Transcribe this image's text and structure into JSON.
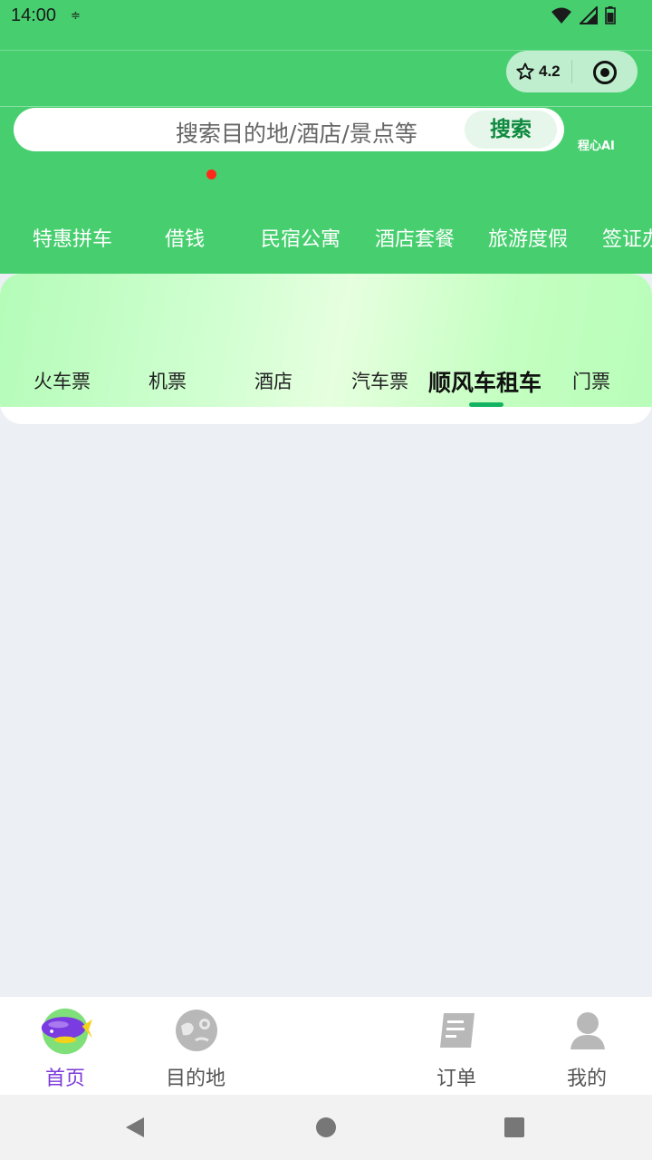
{
  "status_bar": {
    "time": "14:00",
    "extra": "≑"
  },
  "capsule": {
    "rating": "4.2"
  },
  "search": {
    "placeholder": "搜索目的地/酒店/景点等",
    "button_label": "搜索",
    "ai_label": "程心AI"
  },
  "quick_nav": {
    "items": [
      "特惠拼车",
      "借钱",
      "民宿公寓",
      "酒店套餐",
      "旅游度假",
      "签证办"
    ]
  },
  "tabs": {
    "items": [
      "火车票",
      "机票",
      "酒店",
      "汽车票",
      "顺风车租车",
      "门票"
    ],
    "active": "顺风车租车"
  },
  "bottom_nav": {
    "items": [
      {
        "label": "首页",
        "icon": "blimp-icon",
        "active": true
      },
      {
        "label": "目的地",
        "icon": "palette-globe-icon",
        "active": false
      },
      {
        "label": "订单",
        "icon": "order-note-icon",
        "active": false
      },
      {
        "label": "我的",
        "icon": "user-icon",
        "active": false
      }
    ]
  },
  "colors": {
    "brand_green": "#47CF6F",
    "tab_indicator": "#14B362",
    "active_nav": "#7C3AD9",
    "search_button_text": "#0E8A3E"
  }
}
